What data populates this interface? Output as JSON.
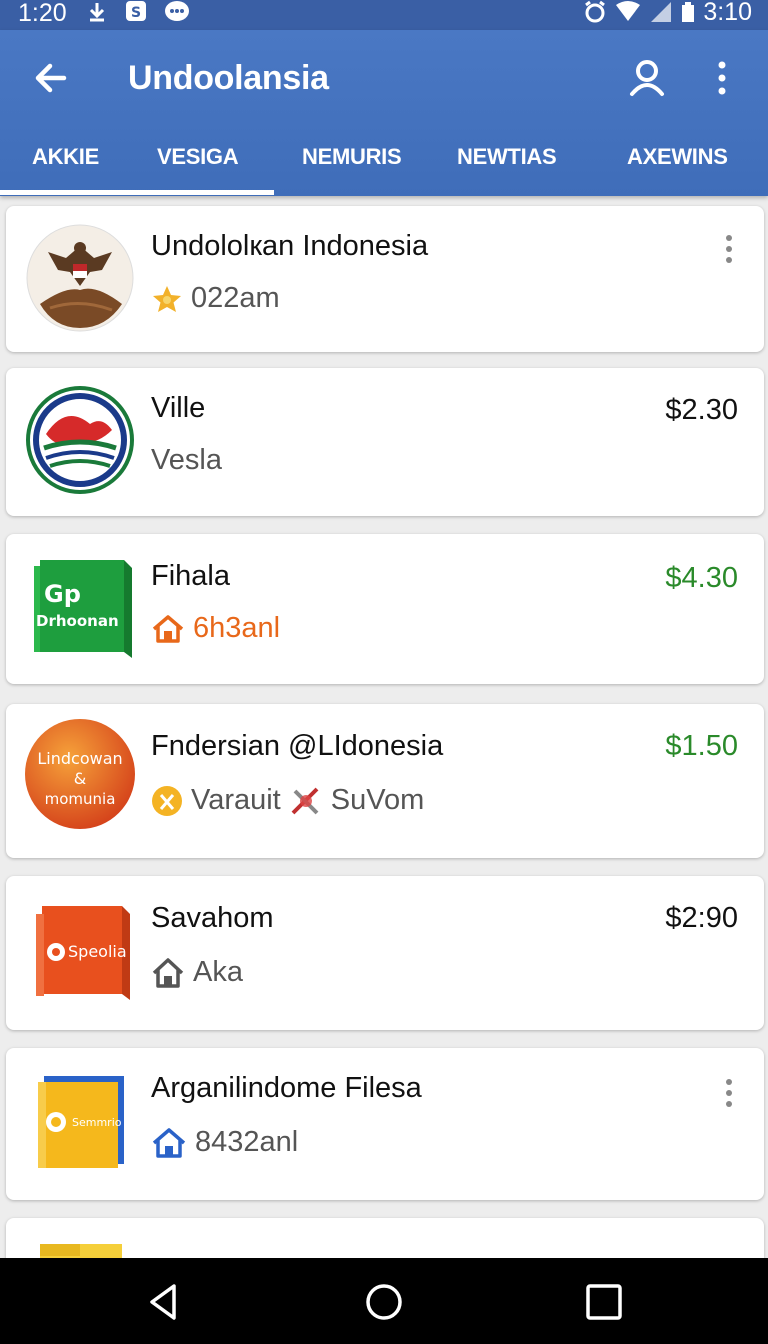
{
  "status_bar": {
    "time": "1:20",
    "right_time": "3:10"
  },
  "app_bar": {
    "title": "Undoolansia"
  },
  "tabs": [
    {
      "label": "AKKIE"
    },
    {
      "label": "VESIGA"
    },
    {
      "label": "NEMURIS"
    },
    {
      "label": "NEWTIAS"
    },
    {
      "label": "AXEWINS"
    }
  ],
  "items": [
    {
      "title": "Undololкan Indonesia",
      "subtitle": "022am",
      "price": "",
      "subtitle_icon": "star-icon"
    },
    {
      "title": "Ville",
      "subtitle": "Vesla",
      "price": "$2.30",
      "subtitle_icon": ""
    },
    {
      "title": "Fihala",
      "subtitle": "6h3anl",
      "price": "$4.30",
      "subtitle_icon": "home-icon",
      "logo_line1": "Gp",
      "logo_line2": "Drhoonan"
    },
    {
      "title": "Fndersian @LIdonesia",
      "subtitle": "Varauit",
      "subtitle2": "SuVom",
      "price": "$1.50",
      "subtitle_icon": "ribbon-icon",
      "logo_line1": "Lindcowan",
      "logo_line2": "&",
      "logo_line3": "momunia"
    },
    {
      "title": "Savahom",
      "subtitle": "Aka",
      "price": "$2:90",
      "subtitle_icon": "home-icon",
      "logo_line1": "Speolia"
    },
    {
      "title": "Arganilindome Filesa",
      "subtitle": "8432anl",
      "price": "",
      "subtitle_icon": "home-icon",
      "logo_line1": "Semmrio"
    }
  ],
  "colors": {
    "primary": "#4a78c4",
    "status": "#3a5fa5",
    "price_green": "#2a8a2a",
    "orange": "#e8681a"
  }
}
